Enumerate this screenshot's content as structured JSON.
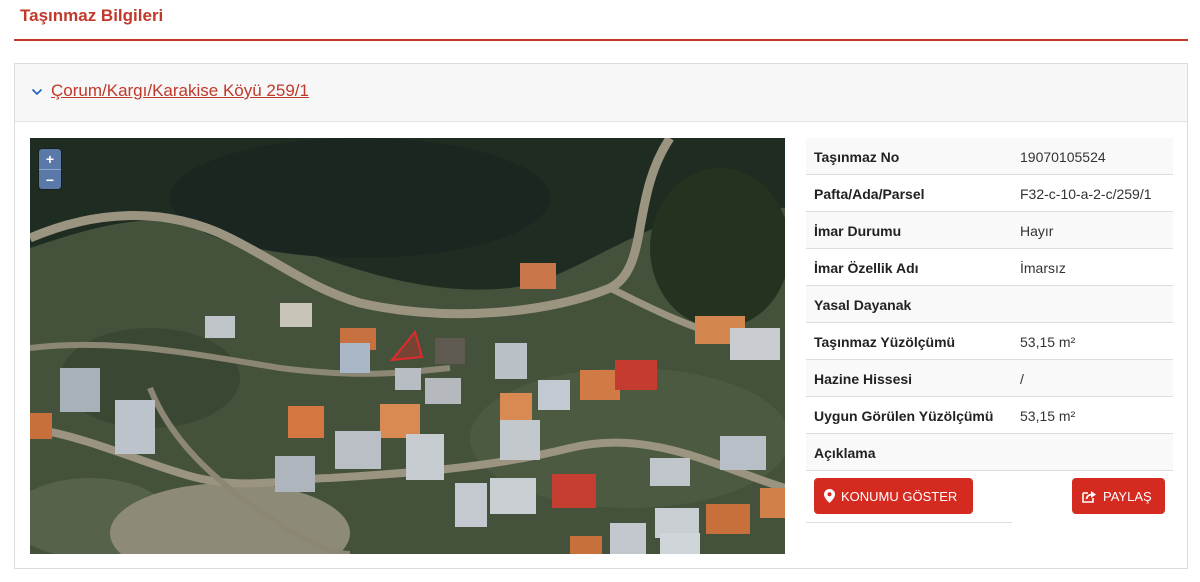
{
  "page": {
    "title": "Taşınmaz Bilgileri"
  },
  "panel": {
    "heading": "Çorum/Kargı/Karakise Köyü 259/1"
  },
  "map": {
    "zoom_in": "+",
    "zoom_out": "−"
  },
  "details": [
    {
      "label": "Taşınmaz No",
      "value": "19070105524"
    },
    {
      "label": "Pafta/Ada/Parsel",
      "value": "F32-c-10-a-2-c/259/1"
    },
    {
      "label": "İmar Durumu",
      "value": "Hayır"
    },
    {
      "label": "İmar Özellik Adı",
      "value": "İmarsız"
    },
    {
      "label": "Yasal Dayanak",
      "value": ""
    },
    {
      "label": "Taşınmaz Yüzölçümü",
      "value": "53,15 m²"
    },
    {
      "label": "Hazine Hissesi",
      "value": "/"
    },
    {
      "label": "Uygun Görülen Yüzölçümü",
      "value": "53,15 m²"
    },
    {
      "label": "Açıklama",
      "value": ""
    }
  ],
  "buttons": {
    "show_location": "KONUMU GÖSTER",
    "share": "PAYLAŞ"
  },
  "colors": {
    "accent": "#c0392b",
    "button": "#d42a20",
    "zoom": "#5a78a8"
  }
}
